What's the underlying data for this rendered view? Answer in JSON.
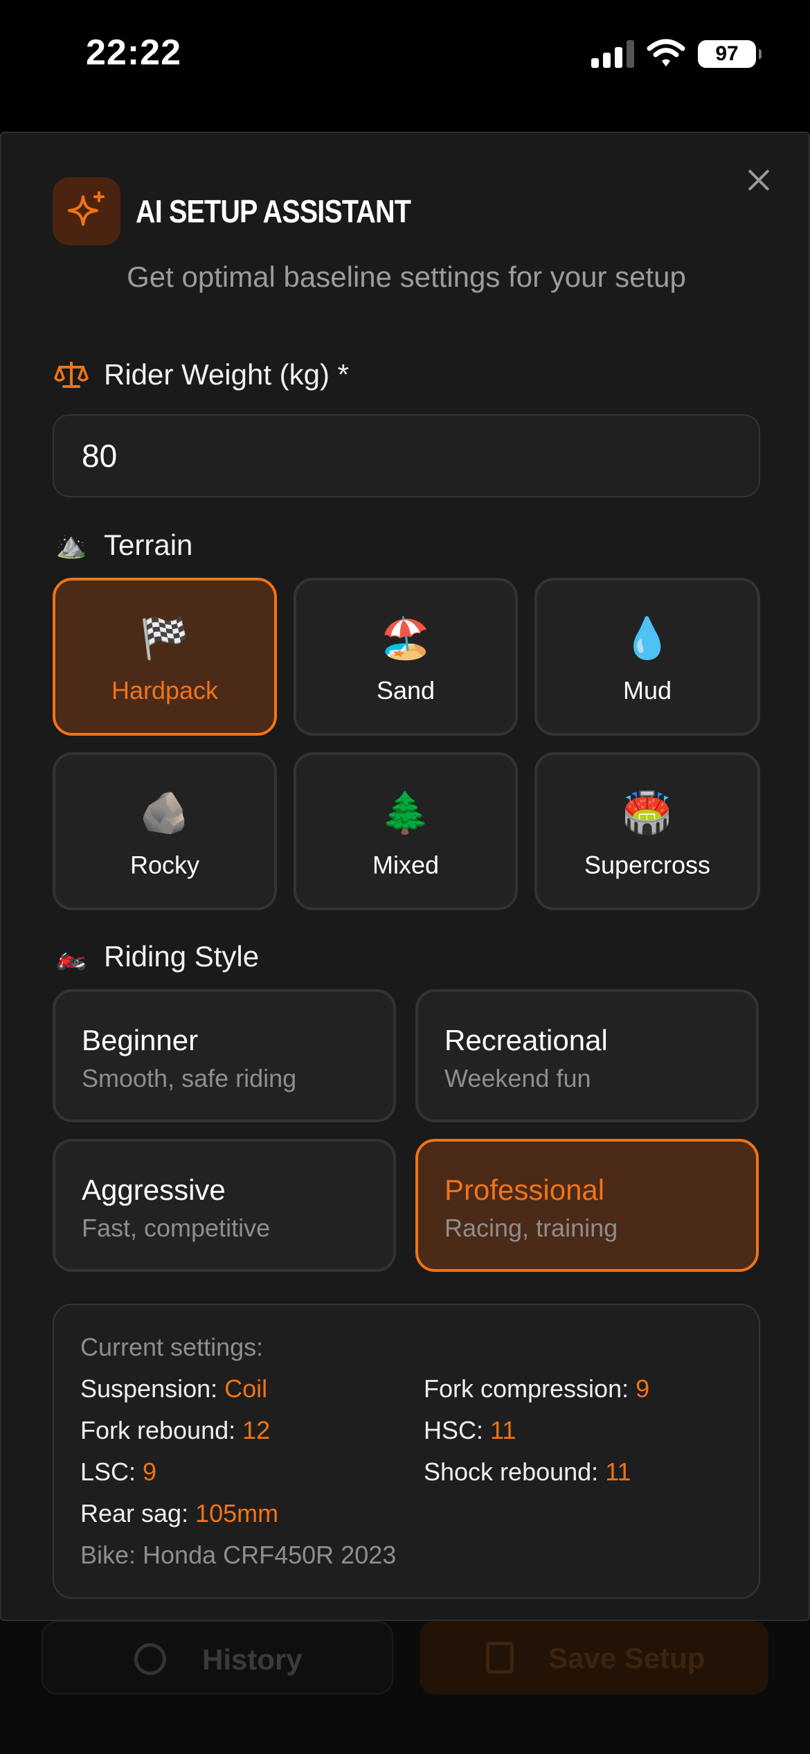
{
  "status_bar": {
    "time": "22:22",
    "battery": "97"
  },
  "modal": {
    "title": "AI SETUP ASSISTANT",
    "subtitle": "Get optimal baseline settings for your setup",
    "weight": {
      "label": "Rider Weight (kg) *",
      "value": "80"
    },
    "terrain": {
      "label": "Terrain",
      "options": [
        {
          "label": "Hardpack",
          "emoji": "🏁",
          "selected": true
        },
        {
          "label": "Sand",
          "emoji": "🏖️",
          "selected": false
        },
        {
          "label": "Mud",
          "emoji": "💧",
          "selected": false
        },
        {
          "label": "Rocky",
          "emoji": "🪨",
          "selected": false
        },
        {
          "label": "Mixed",
          "emoji": "🌲",
          "selected": false
        },
        {
          "label": "Supercross",
          "emoji": "🏟️",
          "selected": false
        }
      ]
    },
    "riding_style": {
      "label": "Riding Style",
      "options": [
        {
          "name": "Beginner",
          "desc": "Smooth, safe riding",
          "selected": false
        },
        {
          "name": "Recreational",
          "desc": "Weekend fun",
          "selected": false
        },
        {
          "name": "Aggressive",
          "desc": "Fast, competitive",
          "selected": false
        },
        {
          "name": "Professional",
          "desc": "Racing, training",
          "selected": true
        }
      ]
    },
    "current_settings": {
      "heading": "Current settings:",
      "suspension": {
        "label": "Suspension: ",
        "value": "Coil"
      },
      "fork_compression": {
        "label": "Fork compression: ",
        "value": "9"
      },
      "fork_rebound": {
        "label": "Fork rebound: ",
        "value": "12"
      },
      "hsc": {
        "label": "HSC: ",
        "value": "11"
      },
      "lsc": {
        "label": "LSC: ",
        "value": "9"
      },
      "shock_rebound": {
        "label": "Shock rebound: ",
        "value": "11"
      },
      "rear_sag": {
        "label": "Rear sag: ",
        "value": "105mm"
      },
      "bike": "Bike: Honda CRF450R 2023"
    }
  },
  "background_actions": {
    "history": "History",
    "save": "Save Setup"
  },
  "colors": {
    "accent": "#f07417",
    "selected_bg": "#4b2a17",
    "sheet_bg": "#1a1a1a"
  },
  "icons": [
    "signal-icon",
    "wifi-icon",
    "close-icon",
    "sparkle-icon",
    "scale-icon",
    "mountain-icon",
    "motorcycle-icon",
    "history-icon",
    "save-icon"
  ]
}
